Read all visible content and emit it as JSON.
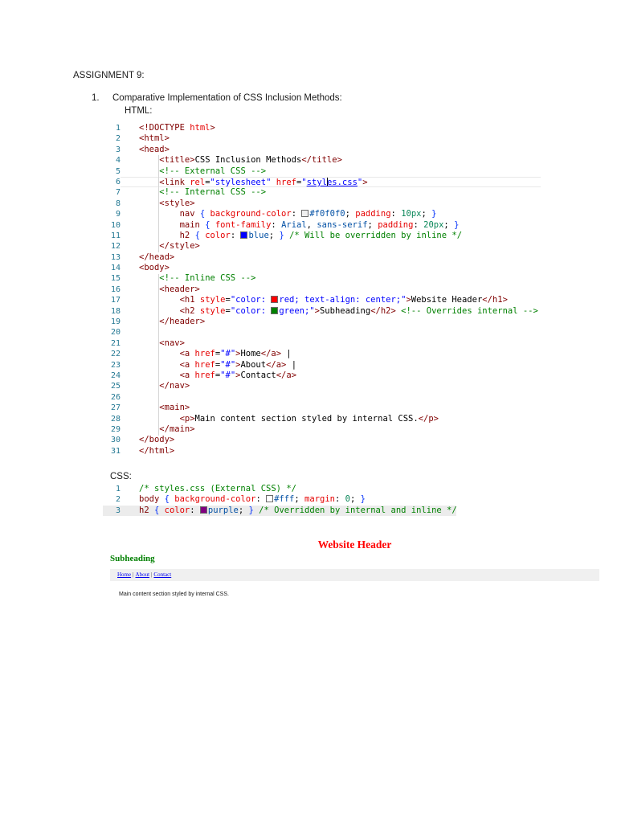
{
  "page": {
    "assignment_title": "ASSIGNMENT 9:",
    "item_number": "1.",
    "item_title": "Comparative Implementation of CSS Inclusion Methods:",
    "html_label": "HTML:",
    "css_label": "CSS:"
  },
  "editor": {
    "palette": {
      "tag": "#800000",
      "attr": "#e50000",
      "str": "#0000ff",
      "comment": "#008000",
      "text": "#000000",
      "sel": "#800000",
      "prop": "#e50000",
      "val": "#0451a5",
      "num": "#098658",
      "brace": "#0431fa",
      "punct": "#000000",
      "ln": "#237893",
      "curborder": "#e8e8e8",
      "curbg": "#ececec",
      "guide": "#d6d6d6"
    }
  },
  "html_code": {
    "current_line": 6,
    "lines": [
      {
        "n": 1,
        "t": [
          [
            "tag",
            "<!DOCTYPE "
          ],
          [
            "attr",
            "html"
          ],
          [
            "tag",
            ">"
          ]
        ]
      },
      {
        "n": 2,
        "t": [
          [
            "tag",
            "<html>"
          ]
        ]
      },
      {
        "n": 3,
        "t": [
          [
            "tag",
            "<head>"
          ]
        ]
      },
      {
        "n": 4,
        "t": [
          [
            "text",
            "    "
          ],
          [
            "tag",
            "<title>"
          ],
          [
            "text",
            "CSS Inclusion Methods"
          ],
          [
            "tag",
            "</title>"
          ]
        ]
      },
      {
        "n": 5,
        "t": [
          [
            "text",
            "    "
          ],
          [
            "comment",
            "<!-- External CSS -->"
          ]
        ]
      },
      {
        "n": 6,
        "t": [
          [
            "text",
            "    "
          ],
          [
            "tag",
            "<link "
          ],
          [
            "attr",
            "rel"
          ],
          [
            "punct",
            "="
          ],
          [
            "str",
            "\"stylesheet\""
          ],
          [
            "text",
            " "
          ],
          [
            "attr",
            "href"
          ],
          [
            "punct",
            "="
          ],
          [
            "str",
            "\""
          ],
          [
            "stru",
            "styl"
          ],
          [
            "cursor",
            ""
          ],
          [
            "stru",
            "es.css"
          ],
          [
            "str",
            "\""
          ],
          [
            "tag",
            ">"
          ]
        ]
      },
      {
        "n": 7,
        "t": [
          [
            "text",
            "    "
          ],
          [
            "comment",
            "<!-- Internal CSS -->"
          ]
        ]
      },
      {
        "n": 8,
        "t": [
          [
            "text",
            "    "
          ],
          [
            "tag",
            "<style>"
          ]
        ]
      },
      {
        "n": 9,
        "t": [
          [
            "text",
            "        "
          ],
          [
            "sel",
            "nav"
          ],
          [
            "text",
            " "
          ],
          [
            "brace",
            "{"
          ],
          [
            "text",
            " "
          ],
          [
            "prop",
            "background-color"
          ],
          [
            "punct",
            ":"
          ],
          [
            "text",
            " "
          ],
          [
            "swatch",
            "#f0f0f0"
          ],
          [
            "val",
            "#f0f0f0"
          ],
          [
            "punct",
            ";"
          ],
          [
            "text",
            " "
          ],
          [
            "prop",
            "padding"
          ],
          [
            "punct",
            ":"
          ],
          [
            "text",
            " "
          ],
          [
            "num",
            "10px"
          ],
          [
            "punct",
            ";"
          ],
          [
            "text",
            " "
          ],
          [
            "brace",
            "}"
          ]
        ]
      },
      {
        "n": 10,
        "t": [
          [
            "text",
            "        "
          ],
          [
            "sel",
            "main"
          ],
          [
            "text",
            " "
          ],
          [
            "brace",
            "{"
          ],
          [
            "text",
            " "
          ],
          [
            "prop",
            "font-family"
          ],
          [
            "punct",
            ":"
          ],
          [
            "text",
            " "
          ],
          [
            "val",
            "Arial"
          ],
          [
            "punct",
            ","
          ],
          [
            "text",
            " "
          ],
          [
            "val",
            "sans-serif"
          ],
          [
            "punct",
            ";"
          ],
          [
            "text",
            " "
          ],
          [
            "prop",
            "padding"
          ],
          [
            "punct",
            ":"
          ],
          [
            "text",
            " "
          ],
          [
            "num",
            "20px"
          ],
          [
            "punct",
            ";"
          ],
          [
            "text",
            " "
          ],
          [
            "brace",
            "}"
          ]
        ]
      },
      {
        "n": 11,
        "t": [
          [
            "text",
            "        "
          ],
          [
            "sel",
            "h2"
          ],
          [
            "text",
            " "
          ],
          [
            "brace",
            "{"
          ],
          [
            "text",
            " "
          ],
          [
            "prop",
            "color"
          ],
          [
            "punct",
            ":"
          ],
          [
            "text",
            " "
          ],
          [
            "swatch",
            "#0000ff"
          ],
          [
            "val",
            "blue"
          ],
          [
            "punct",
            ";"
          ],
          [
            "text",
            " "
          ],
          [
            "brace",
            "}"
          ],
          [
            "text",
            " "
          ],
          [
            "comment",
            "/* Will be overridden by inline */"
          ]
        ]
      },
      {
        "n": 12,
        "t": [
          [
            "text",
            "    "
          ],
          [
            "tag",
            "</style>"
          ]
        ]
      },
      {
        "n": 13,
        "t": [
          [
            "tag",
            "</head>"
          ]
        ]
      },
      {
        "n": 14,
        "t": [
          [
            "tag",
            "<body>"
          ]
        ]
      },
      {
        "n": 15,
        "t": [
          [
            "text",
            "    "
          ],
          [
            "comment",
            "<!-- Inline CSS -->"
          ]
        ]
      },
      {
        "n": 16,
        "t": [
          [
            "text",
            "    "
          ],
          [
            "tag",
            "<header>"
          ]
        ]
      },
      {
        "n": 17,
        "t": [
          [
            "text",
            "        "
          ],
          [
            "tag",
            "<h1 "
          ],
          [
            "attr",
            "style"
          ],
          [
            "punct",
            "="
          ],
          [
            "str",
            "\"color: "
          ],
          [
            "swatch",
            "#ff0000"
          ],
          [
            "str",
            "red; text-align: center;\""
          ],
          [
            "tag",
            ">"
          ],
          [
            "text",
            "Website Header"
          ],
          [
            "tag",
            "</h1>"
          ]
        ]
      },
      {
        "n": 18,
        "t": [
          [
            "text",
            "        "
          ],
          [
            "tag",
            "<h2 "
          ],
          [
            "attr",
            "style"
          ],
          [
            "punct",
            "="
          ],
          [
            "str",
            "\"color: "
          ],
          [
            "swatch",
            "#008000"
          ],
          [
            "str",
            "green;\""
          ],
          [
            "tag",
            ">"
          ],
          [
            "text",
            "Subheading"
          ],
          [
            "tag",
            "</h2>"
          ],
          [
            "text",
            " "
          ],
          [
            "comment",
            "<!-- Overrides internal -->"
          ]
        ]
      },
      {
        "n": 19,
        "t": [
          [
            "text",
            "    "
          ],
          [
            "tag",
            "</header>"
          ]
        ]
      },
      {
        "n": 20,
        "t": []
      },
      {
        "n": 21,
        "t": [
          [
            "text",
            "    "
          ],
          [
            "tag",
            "<nav>"
          ]
        ]
      },
      {
        "n": 22,
        "t": [
          [
            "text",
            "        "
          ],
          [
            "tag",
            "<a "
          ],
          [
            "attr",
            "href"
          ],
          [
            "punct",
            "="
          ],
          [
            "str",
            "\"#\""
          ],
          [
            "tag",
            ">"
          ],
          [
            "text",
            "Home"
          ],
          [
            "tag",
            "</a>"
          ],
          [
            "text",
            " |"
          ]
        ]
      },
      {
        "n": 23,
        "t": [
          [
            "text",
            "        "
          ],
          [
            "tag",
            "<a "
          ],
          [
            "attr",
            "href"
          ],
          [
            "punct",
            "="
          ],
          [
            "str",
            "\"#\""
          ],
          [
            "tag",
            ">"
          ],
          [
            "text",
            "About"
          ],
          [
            "tag",
            "</a>"
          ],
          [
            "text",
            " |"
          ]
        ]
      },
      {
        "n": 24,
        "t": [
          [
            "text",
            "        "
          ],
          [
            "tag",
            "<a "
          ],
          [
            "attr",
            "href"
          ],
          [
            "punct",
            "="
          ],
          [
            "str",
            "\"#\""
          ],
          [
            "tag",
            ">"
          ],
          [
            "text",
            "Contact"
          ],
          [
            "tag",
            "</a>"
          ]
        ]
      },
      {
        "n": 25,
        "t": [
          [
            "text",
            "    "
          ],
          [
            "tag",
            "</nav>"
          ]
        ]
      },
      {
        "n": 26,
        "t": []
      },
      {
        "n": 27,
        "t": [
          [
            "text",
            "    "
          ],
          [
            "tag",
            "<main>"
          ]
        ]
      },
      {
        "n": 28,
        "t": [
          [
            "text",
            "        "
          ],
          [
            "tag",
            "<p>"
          ],
          [
            "text",
            "Main content section styled by internal CSS."
          ],
          [
            "tag",
            "</p>"
          ]
        ]
      },
      {
        "n": 29,
        "t": [
          [
            "text",
            "    "
          ],
          [
            "tag",
            "</main>"
          ]
        ]
      },
      {
        "n": 30,
        "t": [
          [
            "tag",
            "</body>"
          ]
        ]
      },
      {
        "n": 31,
        "t": [
          [
            "tag",
            "</html>"
          ]
        ]
      }
    ]
  },
  "css_code": {
    "current_line": 3,
    "lines": [
      {
        "n": 1,
        "t": [
          [
            "comment",
            "/* styles.css (External CSS) */"
          ]
        ]
      },
      {
        "n": 2,
        "t": [
          [
            "sel",
            "body"
          ],
          [
            "text",
            " "
          ],
          [
            "brace",
            "{"
          ],
          [
            "text",
            " "
          ],
          [
            "prop",
            "background-color"
          ],
          [
            "punct",
            ":"
          ],
          [
            "text",
            " "
          ],
          [
            "swatch",
            "#ffffff"
          ],
          [
            "val",
            "#fff"
          ],
          [
            "punct",
            ";"
          ],
          [
            "text",
            " "
          ],
          [
            "prop",
            "margin"
          ],
          [
            "punct",
            ":"
          ],
          [
            "text",
            " "
          ],
          [
            "num",
            "0"
          ],
          [
            "punct",
            ";"
          ],
          [
            "text",
            " "
          ],
          [
            "brace",
            "}"
          ]
        ]
      },
      {
        "n": 3,
        "t": [
          [
            "sel",
            "h2"
          ],
          [
            "text",
            " "
          ],
          [
            "brace",
            "{"
          ],
          [
            "text",
            " "
          ],
          [
            "prop",
            "color"
          ],
          [
            "punct",
            ":"
          ],
          [
            "text",
            " "
          ],
          [
            "swatch",
            "#800080"
          ],
          [
            "val",
            "purple"
          ],
          [
            "punct",
            ";"
          ],
          [
            "text",
            " "
          ],
          [
            "brace",
            "}"
          ],
          [
            "text",
            " "
          ],
          [
            "comment",
            "/* Overridden by internal and inline */"
          ]
        ]
      }
    ]
  },
  "preview": {
    "header_text": "Website Header",
    "subheading_text": "Subheading",
    "nav_links": [
      "Home",
      "About",
      "Contact"
    ],
    "nav_separator": "|",
    "main_text": "Main content section styled by internal CSS.",
    "header_color": "#ff0000",
    "subheading_color": "#008000",
    "link_color": "#0000ee",
    "nav_bg": "#f0f0f0"
  }
}
